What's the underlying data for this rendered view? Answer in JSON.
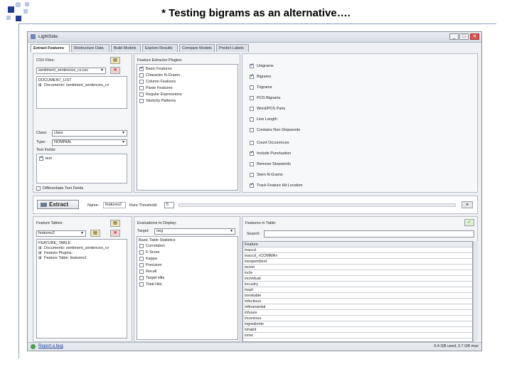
{
  "slide": {
    "title": "* Testing bigrams as an alternative…."
  },
  "window": {
    "title": "LightSide",
    "min_label": "_",
    "max_label": "□",
    "close_label": "✕"
  },
  "tabs": [
    {
      "label": "Extract Features"
    },
    {
      "label": "Restructure Data"
    },
    {
      "label": "Build Models"
    },
    {
      "label": "Explore Results"
    },
    {
      "label": "Compare Models"
    },
    {
      "label": "Predict Labels"
    }
  ],
  "csv": {
    "label": "CSV Files:",
    "selected": "sentiment_sentences_cv.csv",
    "tree": [
      "DOCUMENT_LIST",
      "Documents: sentiment_sentences_cv"
    ]
  },
  "class_field": {
    "label": "Class:",
    "value": "class"
  },
  "type_field": {
    "label": "Type:",
    "value": "NOMINAL"
  },
  "text_fields": {
    "label": "Text Fields:",
    "items": [
      {
        "label": "text",
        "checked": true
      }
    ]
  },
  "differentiate": {
    "label": "Differentiate Text Fields"
  },
  "plugins": {
    "label": "Feature Extractor Plugins:",
    "items": [
      {
        "label": "Basic Features",
        "checked": true
      },
      {
        "label": "Character N-Grams",
        "checked": false
      },
      {
        "label": "Column Features",
        "checked": false
      },
      {
        "label": "Parse Features",
        "checked": false
      },
      {
        "label": "Regular Expressions",
        "checked": false
      },
      {
        "label": "Stretchy Patterns",
        "checked": false
      }
    ]
  },
  "options": [
    {
      "label": "Unigrams",
      "checked": true
    },
    {
      "label": "Bigrams",
      "checked": true
    },
    {
      "label": "Trigrams",
      "checked": false
    },
    {
      "label": "POS Bigrams",
      "checked": false
    },
    {
      "label": "Word/POS Pairs",
      "checked": false
    },
    {
      "label": "Line Length",
      "checked": false
    },
    {
      "label": "Contains Non-Stopwords",
      "checked": false
    },
    {
      "label": "Count Occurences",
      "checked": false
    },
    {
      "label": "Include Punctuation",
      "checked": true
    },
    {
      "label": "Remove Stopwords",
      "checked": false
    },
    {
      "label": "Stem N-Grams",
      "checked": false
    },
    {
      "label": "Track Feature Hit Location",
      "checked": true
    }
  ],
  "extract": {
    "button": "Extract",
    "name_label": "Name:",
    "name_value": "features2",
    "threshold_label": "Rare Threshold:",
    "threshold_value": "5"
  },
  "feature_tables": {
    "label": "Feature Tables:",
    "selected": "features2",
    "tree": [
      "FEATURE_TABLE",
      "Documents: sentiment_sentences_cv",
      "Feature Plugins:",
      "Feature Table: features2"
    ]
  },
  "evaluations": {
    "label": "Evaluations to Display:",
    "target_label": "Target:",
    "target_value": "neg",
    "stats_header": "Basic Table Statistics",
    "items": [
      "Correlation",
      "F-Score",
      "Kappa",
      "Precision",
      "Recall",
      "Target Hits",
      "Total Hits"
    ]
  },
  "features_in_table": {
    "label": "Features in Table:",
    "search_label": "Search:",
    "search_value": "",
    "column_header": "Feature",
    "rows": [
      "inaccd",
      "inaccd_<COMMA>",
      "inexpendient",
      "incion",
      "incle",
      "incividual",
      "incustry",
      "inept",
      "inevitable",
      "infectious",
      "infinanantial",
      "infuses",
      "incenious",
      "ingredients",
      "inhabit",
      "inner"
    ]
  },
  "status": {
    "report_label": "Report a bug",
    "memory": "0.4 GB used, 2.7 GB max"
  }
}
